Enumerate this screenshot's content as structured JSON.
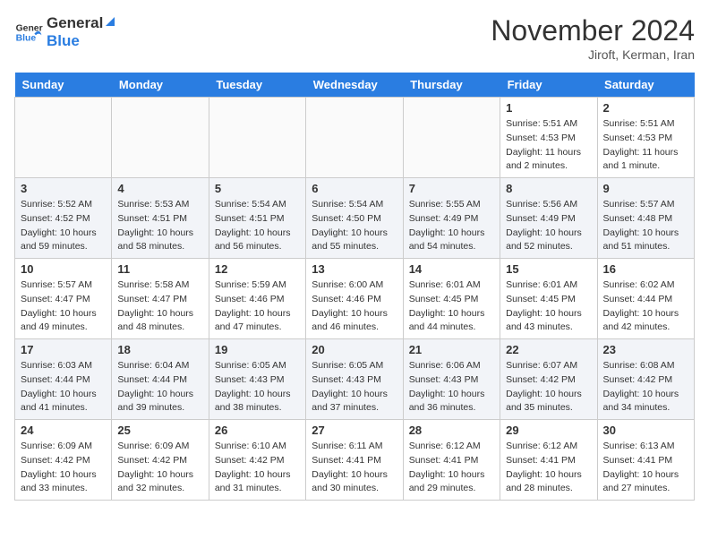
{
  "header": {
    "logo_general": "General",
    "logo_blue": "Blue",
    "month_title": "November 2024",
    "location": "Jiroft, Kerman, Iran"
  },
  "weekdays": [
    "Sunday",
    "Monday",
    "Tuesday",
    "Wednesday",
    "Thursday",
    "Friday",
    "Saturday"
  ],
  "weeks": [
    [
      {
        "day": "",
        "info": ""
      },
      {
        "day": "",
        "info": ""
      },
      {
        "day": "",
        "info": ""
      },
      {
        "day": "",
        "info": ""
      },
      {
        "day": "",
        "info": ""
      },
      {
        "day": "1",
        "info": "Sunrise: 5:51 AM\nSunset: 4:53 PM\nDaylight: 11 hours\nand 2 minutes."
      },
      {
        "day": "2",
        "info": "Sunrise: 5:51 AM\nSunset: 4:53 PM\nDaylight: 11 hours\nand 1 minute."
      }
    ],
    [
      {
        "day": "3",
        "info": "Sunrise: 5:52 AM\nSunset: 4:52 PM\nDaylight: 10 hours\nand 59 minutes."
      },
      {
        "day": "4",
        "info": "Sunrise: 5:53 AM\nSunset: 4:51 PM\nDaylight: 10 hours\nand 58 minutes."
      },
      {
        "day": "5",
        "info": "Sunrise: 5:54 AM\nSunset: 4:51 PM\nDaylight: 10 hours\nand 56 minutes."
      },
      {
        "day": "6",
        "info": "Sunrise: 5:54 AM\nSunset: 4:50 PM\nDaylight: 10 hours\nand 55 minutes."
      },
      {
        "day": "7",
        "info": "Sunrise: 5:55 AM\nSunset: 4:49 PM\nDaylight: 10 hours\nand 54 minutes."
      },
      {
        "day": "8",
        "info": "Sunrise: 5:56 AM\nSunset: 4:49 PM\nDaylight: 10 hours\nand 52 minutes."
      },
      {
        "day": "9",
        "info": "Sunrise: 5:57 AM\nSunset: 4:48 PM\nDaylight: 10 hours\nand 51 minutes."
      }
    ],
    [
      {
        "day": "10",
        "info": "Sunrise: 5:57 AM\nSunset: 4:47 PM\nDaylight: 10 hours\nand 49 minutes."
      },
      {
        "day": "11",
        "info": "Sunrise: 5:58 AM\nSunset: 4:47 PM\nDaylight: 10 hours\nand 48 minutes."
      },
      {
        "day": "12",
        "info": "Sunrise: 5:59 AM\nSunset: 4:46 PM\nDaylight: 10 hours\nand 47 minutes."
      },
      {
        "day": "13",
        "info": "Sunrise: 6:00 AM\nSunset: 4:46 PM\nDaylight: 10 hours\nand 46 minutes."
      },
      {
        "day": "14",
        "info": "Sunrise: 6:01 AM\nSunset: 4:45 PM\nDaylight: 10 hours\nand 44 minutes."
      },
      {
        "day": "15",
        "info": "Sunrise: 6:01 AM\nSunset: 4:45 PM\nDaylight: 10 hours\nand 43 minutes."
      },
      {
        "day": "16",
        "info": "Sunrise: 6:02 AM\nSunset: 4:44 PM\nDaylight: 10 hours\nand 42 minutes."
      }
    ],
    [
      {
        "day": "17",
        "info": "Sunrise: 6:03 AM\nSunset: 4:44 PM\nDaylight: 10 hours\nand 41 minutes."
      },
      {
        "day": "18",
        "info": "Sunrise: 6:04 AM\nSunset: 4:44 PM\nDaylight: 10 hours\nand 39 minutes."
      },
      {
        "day": "19",
        "info": "Sunrise: 6:05 AM\nSunset: 4:43 PM\nDaylight: 10 hours\nand 38 minutes."
      },
      {
        "day": "20",
        "info": "Sunrise: 6:05 AM\nSunset: 4:43 PM\nDaylight: 10 hours\nand 37 minutes."
      },
      {
        "day": "21",
        "info": "Sunrise: 6:06 AM\nSunset: 4:43 PM\nDaylight: 10 hours\nand 36 minutes."
      },
      {
        "day": "22",
        "info": "Sunrise: 6:07 AM\nSunset: 4:42 PM\nDaylight: 10 hours\nand 35 minutes."
      },
      {
        "day": "23",
        "info": "Sunrise: 6:08 AM\nSunset: 4:42 PM\nDaylight: 10 hours\nand 34 minutes."
      }
    ],
    [
      {
        "day": "24",
        "info": "Sunrise: 6:09 AM\nSunset: 4:42 PM\nDaylight: 10 hours\nand 33 minutes."
      },
      {
        "day": "25",
        "info": "Sunrise: 6:09 AM\nSunset: 4:42 PM\nDaylight: 10 hours\nand 32 minutes."
      },
      {
        "day": "26",
        "info": "Sunrise: 6:10 AM\nSunset: 4:42 PM\nDaylight: 10 hours\nand 31 minutes."
      },
      {
        "day": "27",
        "info": "Sunrise: 6:11 AM\nSunset: 4:41 PM\nDaylight: 10 hours\nand 30 minutes."
      },
      {
        "day": "28",
        "info": "Sunrise: 6:12 AM\nSunset: 4:41 PM\nDaylight: 10 hours\nand 29 minutes."
      },
      {
        "day": "29",
        "info": "Sunrise: 6:12 AM\nSunset: 4:41 PM\nDaylight: 10 hours\nand 28 minutes."
      },
      {
        "day": "30",
        "info": "Sunrise: 6:13 AM\nSunset: 4:41 PM\nDaylight: 10 hours\nand 27 minutes."
      }
    ]
  ]
}
